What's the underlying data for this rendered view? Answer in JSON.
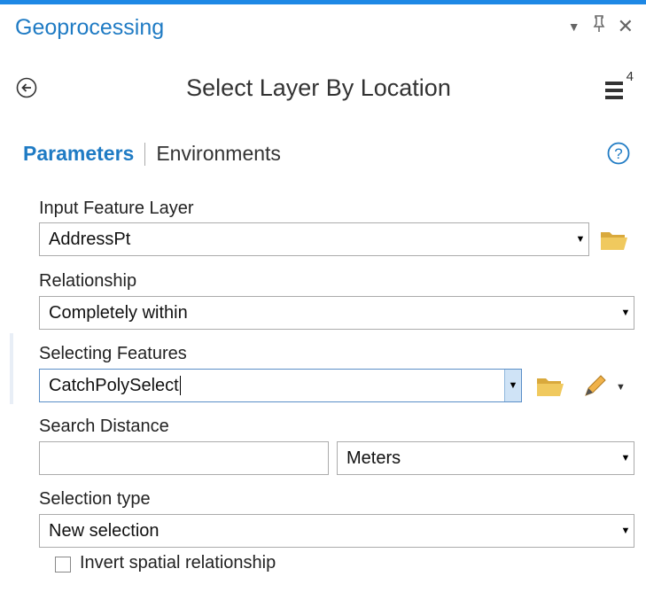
{
  "pane": {
    "title": "Geoprocessing",
    "controls": {
      "dropdown_icon": "chevron-down-icon",
      "pin_icon": "pin-icon",
      "close_icon": "close-icon"
    }
  },
  "tool": {
    "title": "Select Layer By Location",
    "back_icon": "back-arrow-circle-icon",
    "menu_badge": "4"
  },
  "tabs": {
    "active": "Parameters",
    "other": "Environments"
  },
  "params": {
    "input_layer": {
      "label": "Input Feature Layer",
      "value": "AddressPt"
    },
    "relationship": {
      "label": "Relationship",
      "value": "Completely within"
    },
    "selecting": {
      "label": "Selecting Features",
      "value": "CatchPolySelect"
    },
    "search_distance": {
      "label": "Search Distance",
      "value": "",
      "unit": "Meters"
    },
    "selection_type": {
      "label": "Selection type",
      "value": "New selection"
    },
    "invert": {
      "label": "Invert spatial relationship",
      "checked": false
    }
  },
  "colors": {
    "accent": "#1f7bc4",
    "folder": "#e8c15a",
    "pencil": "#e0a030"
  }
}
